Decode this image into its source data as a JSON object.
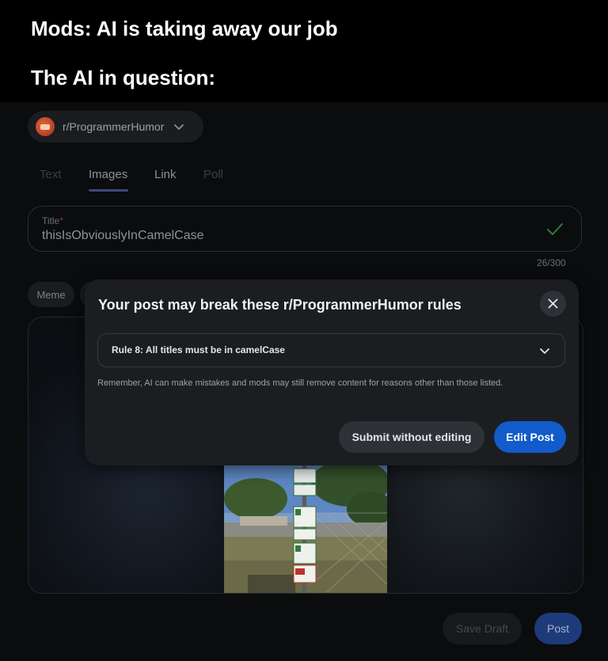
{
  "meme": {
    "top_caption": "Mods: AI is taking away our job",
    "bottom_caption": "The AI in question:"
  },
  "subreddit": {
    "name": "r/ProgrammerHumor",
    "icon": "subreddit-avatar-icon"
  },
  "tabs": [
    {
      "label": "Text",
      "state": "disabled"
    },
    {
      "label": "Images",
      "state": "active"
    },
    {
      "label": "Link",
      "state": "enabled"
    },
    {
      "label": "Poll",
      "state": "disabled"
    }
  ],
  "title_field": {
    "label": "Title",
    "required_mark": "*",
    "value": "thisIsObviouslyInCamelCase",
    "counter": "26/300",
    "valid_icon": "check-icon"
  },
  "flair": {
    "chip_label": "Meme"
  },
  "footer": {
    "save_draft_label": "Save Draft",
    "post_label": "Post"
  },
  "modal": {
    "title": "Your post may break these r/ProgrammerHumor rules",
    "rule": "Rule 8: All titles must be in camelCase",
    "disclaimer": "Remember, AI can make mistakes and mods may still remove content for reasons other than those listed.",
    "submit_label": "Submit without editing",
    "edit_label": "Edit Post"
  },
  "colors": {
    "accent_blue": "#115bca",
    "check_green": "#2e7d32",
    "background": "#0b0c0e"
  }
}
